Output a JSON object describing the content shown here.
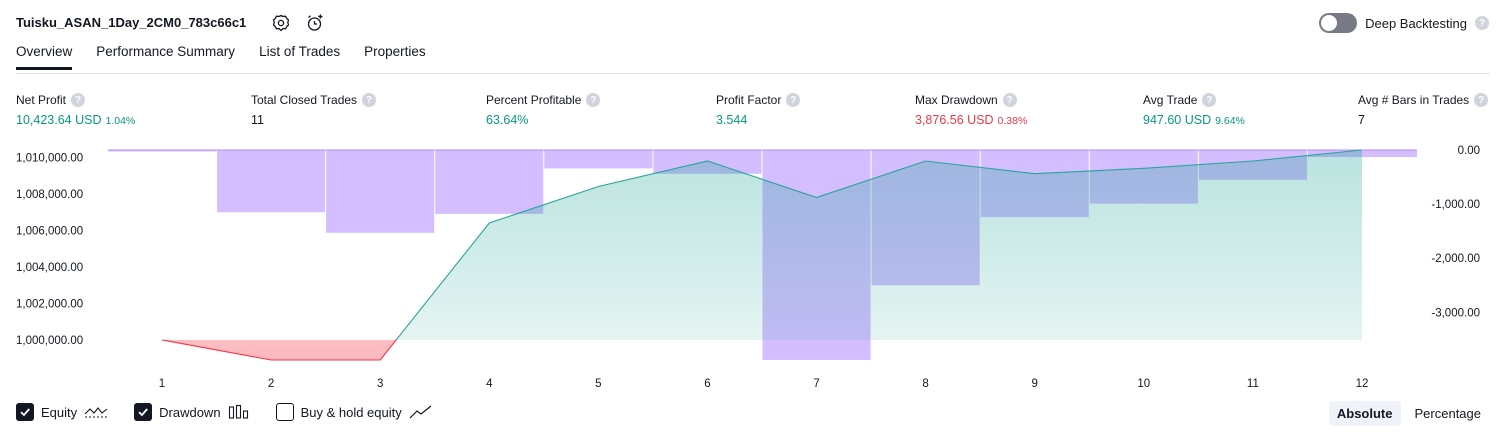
{
  "header": {
    "title": "Tuisku_ASAN_1Day_2CM0_783c66c1",
    "settings_icon": "gear-icon",
    "alert_icon": "add-alert-icon",
    "deep_backtesting_label": "Deep Backtesting",
    "deep_backtesting_on": false,
    "help_glyph": "?"
  },
  "tabs": [
    {
      "label": "Overview",
      "active": true
    },
    {
      "label": "Performance Summary",
      "active": false
    },
    {
      "label": "List of Trades",
      "active": false
    },
    {
      "label": "Properties",
      "active": false
    }
  ],
  "metrics": [
    {
      "label": "Net Profit",
      "value": "10,423.64 USD",
      "pct": "1.04%",
      "tone": "pos"
    },
    {
      "label": "Total Closed Trades",
      "value": "11",
      "pct": "",
      "tone": "neu"
    },
    {
      "label": "Percent Profitable",
      "value": "63.64%",
      "pct": "",
      "tone": "pos"
    },
    {
      "label": "Profit Factor",
      "value": "3.544",
      "pct": "",
      "tone": "pos"
    },
    {
      "label": "Max Drawdown",
      "value": "3,876.56 USD",
      "pct": "0.38%",
      "tone": "neg"
    },
    {
      "label": "Avg Trade",
      "value": "947.60 USD",
      "pct": "9.64%",
      "tone": "pos"
    },
    {
      "label": "Avg # Bars in Trades",
      "value": "7",
      "pct": "",
      "tone": "neu"
    }
  ],
  "chart_data": {
    "type": "line",
    "x": [
      "1",
      "2",
      "3",
      "4",
      "5",
      "6",
      "7",
      "8",
      "9",
      "10",
      "11",
      "12"
    ],
    "series": [
      {
        "name": "Equity",
        "axis": "left",
        "values": [
          1000000,
          998900,
          998900,
          1006400,
          1008400,
          1009800,
          1007800,
          1009800,
          1009100,
          1009400,
          1009800,
          1010400
        ]
      },
      {
        "name": "Drawdown",
        "axis": "right",
        "type": "bar",
        "values": [
          0,
          -1150,
          -1530,
          -1180,
          -340,
          -440,
          -3880,
          -2500,
          -1240,
          -990,
          -550,
          -130
        ]
      }
    ],
    "y_left_ticks": [
      "1,010,000.00",
      "1,008,000.00",
      "1,006,000.00",
      "1,004,000.00",
      "1,002,000.00",
      "1,000,000.00"
    ],
    "y_left_range": [
      998900,
      1010400
    ],
    "y_right_ticks": [
      "0.00",
      "-1,000.00",
      "-2,000.00",
      "-3,000.00"
    ],
    "y_right_range": [
      -3880,
      0
    ],
    "baseline": 1000000,
    "colors": {
      "equity_line_up": "#26a69a",
      "equity_line_down": "#f23645",
      "equity_fill_up": "#26a69a",
      "equity_fill_down": "#f23645",
      "drawdown_bar": "#b388ff"
    }
  },
  "legend": [
    {
      "label": "Equity",
      "checked": true,
      "icon": "equity-line-icon"
    },
    {
      "label": "Drawdown",
      "checked": true,
      "icon": "drawdown-bars-icon"
    },
    {
      "label": "Buy & hold equity",
      "checked": false,
      "icon": "buy-hold-line-icon"
    }
  ],
  "scale_mode": {
    "options": [
      "Absolute",
      "Percentage"
    ],
    "selected": "Absolute"
  }
}
